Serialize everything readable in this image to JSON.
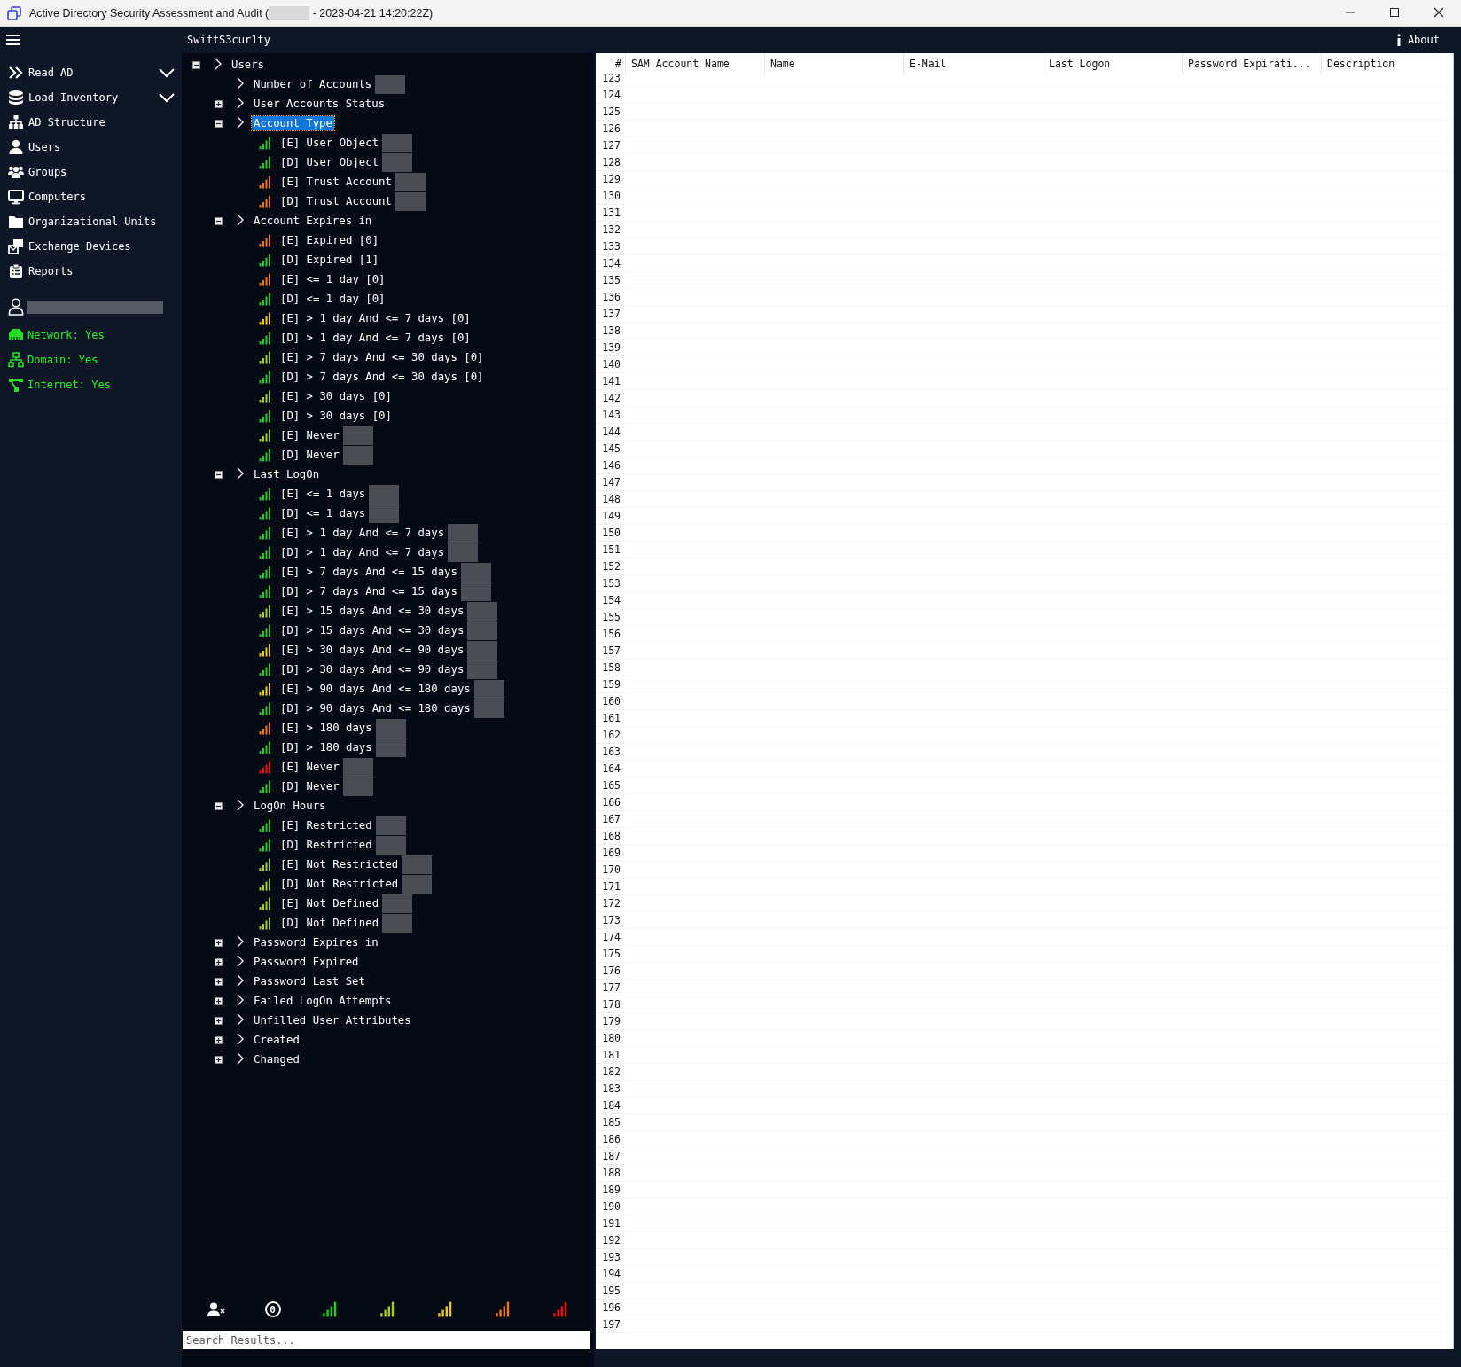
{
  "window": {
    "title_start": "Active Directory Security Assessment and Audit (",
    "title_end": " - 2023-04-21 14:20:22Z)"
  },
  "app_bar": {
    "brand": "SwiftS3cur1ty",
    "about": "About"
  },
  "sidebar": {
    "items": [
      {
        "kind": "read",
        "label": "Read AD",
        "has_submenu": true
      },
      {
        "kind": "database",
        "label": "Load Inventory",
        "has_submenu": true
      },
      {
        "kind": "structure",
        "label": "AD Structure",
        "has_submenu": false
      },
      {
        "kind": "user",
        "label": "Users",
        "has_submenu": false
      },
      {
        "kind": "groups",
        "label": "Groups",
        "has_submenu": false
      },
      {
        "kind": "computer",
        "label": "Computers",
        "has_submenu": false
      },
      {
        "kind": "folder",
        "label": "Organizational Units",
        "has_submenu": false
      },
      {
        "kind": "exchange",
        "label": "Exchange Devices",
        "has_submenu": false
      },
      {
        "kind": "reports",
        "label": "Reports",
        "has_submenu": false
      }
    ],
    "status": [
      {
        "kind": "network",
        "label": "Network: Yes"
      },
      {
        "kind": "domain",
        "label": "Domain: Yes"
      },
      {
        "kind": "internet",
        "label": "Internet: Yes"
      }
    ]
  },
  "tree": [
    {
      "label": "Users",
      "expanded": true,
      "selected": false,
      "children": [
        {
          "label": "Number of Accounts",
          "selected": false,
          "redacted": true
        },
        {
          "label": "User Accounts Status",
          "expanded": false,
          "selected": false
        },
        {
          "label": "Account Type",
          "expanded": true,
          "selected": true,
          "children": [
            {
              "label": "[E] User Object",
              "color": "#22cc22",
              "selected": false,
              "redacted": true
            },
            {
              "label": "[D] User Object",
              "color": "#22cc22",
              "selected": false,
              "redacted": true
            },
            {
              "label": "[E] Trust Account",
              "color": "#ee7711",
              "selected": false,
              "redacted": true
            },
            {
              "label": "[D] Trust Account",
              "color": "#ee7711",
              "selected": false,
              "redacted": true
            }
          ]
        },
        {
          "label": "Account Expires in",
          "expanded": true,
          "selected": false,
          "children": [
            {
              "label": "[E] Expired [0]",
              "color": "#ee7711",
              "selected": false,
              "redacted": false
            },
            {
              "label": "[D] Expired [1]",
              "color": "#22cc22",
              "selected": false,
              "redacted": false
            },
            {
              "label": "[E] <= 1 day [0]",
              "color": "#ee7711",
              "selected": false,
              "redacted": false
            },
            {
              "label": "[D] <= 1 day [0]",
              "color": "#22cc22",
              "selected": false,
              "redacted": false
            },
            {
              "label": "[E] > 1 day And <= 7 days [0]",
              "color": "#eecc00",
              "selected": false,
              "redacted": false
            },
            {
              "label": "[D] > 1 day And <= 7 days [0]",
              "color": "#22cc22",
              "selected": false,
              "redacted": false
            },
            {
              "label": "[E] > 7 days And <= 30 days [0]",
              "color": "#aacc22",
              "selected": false,
              "redacted": false
            },
            {
              "label": "[D] > 7 days And <= 30 days [0]",
              "color": "#22cc22",
              "selected": false,
              "redacted": false
            },
            {
              "label": "[E] > 30 days [0]",
              "color": "#aacc22",
              "selected": false,
              "redacted": false
            },
            {
              "label": "[D] > 30 days [0]",
              "color": "#22cc22",
              "selected": false,
              "redacted": false
            },
            {
              "label": "[E] Never",
              "color": "#aacc22",
              "selected": false,
              "redacted": true
            },
            {
              "label": "[D] Never",
              "color": "#22cc22",
              "selected": false,
              "redacted": true
            }
          ]
        },
        {
          "label": "Last LogOn",
          "expanded": true,
          "selected": false,
          "children": [
            {
              "label": "[E] <= 1 days",
              "color": "#22cc22",
              "selected": false,
              "redacted": true
            },
            {
              "label": "[D] <= 1 days",
              "color": "#22cc22",
              "selected": false,
              "redacted": true
            },
            {
              "label": "[E] > 1 day And <= 7 days",
              "color": "#22cc22",
              "selected": false,
              "redacted": true
            },
            {
              "label": "[D] > 1 day And <= 7 days",
              "color": "#22cc22",
              "selected": false,
              "redacted": true
            },
            {
              "label": "[E] > 7 days And <= 15 days",
              "color": "#22cc22",
              "selected": false,
              "redacted": true
            },
            {
              "label": "[D] > 7 days And <= 15 days",
              "color": "#22cc22",
              "selected": false,
              "redacted": true
            },
            {
              "label": "[E] > 15 days And <= 30 days",
              "color": "#aacc22",
              "selected": false,
              "redacted": true
            },
            {
              "label": "[D] > 15 days And <= 30 days",
              "color": "#22cc22",
              "selected": false,
              "redacted": true
            },
            {
              "label": "[E] > 30 days And <= 90 days",
              "color": "#eecc00",
              "selected": false,
              "redacted": true
            },
            {
              "label": "[D] > 30 days And <= 90 days",
              "color": "#22cc22",
              "selected": false,
              "redacted": true
            },
            {
              "label": "[E] > 90 days And <= 180 days",
              "color": "#eecc00",
              "selected": false,
              "redacted": true
            },
            {
              "label": "[D] > 90 days And <= 180 days",
              "color": "#22cc22",
              "selected": false,
              "redacted": true
            },
            {
              "label": "[E] > 180 days",
              "color": "#ee7711",
              "selected": false,
              "redacted": true
            },
            {
              "label": "[D] > 180 days",
              "color": "#22cc22",
              "selected": false,
              "redacted": true
            },
            {
              "label": "[E] Never",
              "color": "#ee1111",
              "selected": false,
              "redacted": true
            },
            {
              "label": "[D] Never",
              "color": "#22cc22",
              "selected": false,
              "redacted": true
            }
          ]
        },
        {
          "label": "LogOn Hours",
          "expanded": true,
          "selected": false,
          "children": [
            {
              "label": "[E] Restricted",
              "color": "#22cc22",
              "selected": false,
              "redacted": true
            },
            {
              "label": "[D] Restricted",
              "color": "#22cc22",
              "selected": false,
              "redacted": true
            },
            {
              "label": "[E] Not Restricted",
              "color": "#aacc22",
              "selected": false,
              "redacted": true
            },
            {
              "label": "[D] Not Restricted",
              "color": "#aacc22",
              "selected": false,
              "redacted": true
            },
            {
              "label": "[E] Not Defined",
              "color": "#aacc22",
              "selected": false,
              "redacted": true
            },
            {
              "label": "[D] Not Defined",
              "color": "#aacc22",
              "selected": false,
              "redacted": true
            }
          ]
        },
        {
          "label": "Password Expires in",
          "expanded": false,
          "selected": false
        },
        {
          "label": "Password Expired",
          "expanded": false,
          "selected": false
        },
        {
          "label": "Password Last Set",
          "expanded": false,
          "selected": false
        },
        {
          "label": "Failed LogOn Attempts",
          "expanded": false,
          "selected": false
        },
        {
          "label": "Unfilled User Attributes",
          "expanded": false,
          "selected": false
        },
        {
          "label": "Created",
          "expanded": false,
          "selected": false
        },
        {
          "label": "Changed",
          "expanded": false,
          "selected": false
        }
      ]
    }
  ],
  "toolbar": [
    {
      "kind": "user-remove"
    },
    {
      "kind": "zero",
      "text": "0"
    },
    {
      "kind": "signal",
      "color": "#22cc22"
    },
    {
      "kind": "signal",
      "color": "#aacc22"
    },
    {
      "kind": "signal",
      "color": "#eecc00"
    },
    {
      "kind": "signal",
      "color": "#ee7711"
    },
    {
      "kind": "signal",
      "color": "#ee1111"
    }
  ],
  "search": {
    "placeholder": "Search Results..."
  },
  "table": {
    "columns": [
      "#",
      "SAM Account Name",
      "Name",
      "E-Mail",
      "Last Logon",
      "Password Expirati...",
      "Description"
    ],
    "rows": [
      "123",
      "124",
      "125",
      "126",
      "127",
      "128",
      "129",
      "130",
      "131",
      "132",
      "133",
      "134",
      "135",
      "136",
      "137",
      "138",
      "139",
      "140",
      "141",
      "142",
      "143",
      "144",
      "145",
      "146",
      "147",
      "148",
      "149",
      "150",
      "151",
      "152",
      "153",
      "154",
      "155",
      "156",
      "157",
      "158",
      "159",
      "160",
      "161",
      "162",
      "163",
      "164",
      "165",
      "166",
      "167",
      "168",
      "169",
      "170",
      "171",
      "172",
      "173",
      "174",
      "175",
      "176",
      "177",
      "178",
      "179",
      "180",
      "181",
      "182",
      "183",
      "184",
      "185",
      "186",
      "187",
      "188",
      "189",
      "190",
      "191",
      "192",
      "193",
      "194",
      "195",
      "196",
      "197"
    ]
  }
}
